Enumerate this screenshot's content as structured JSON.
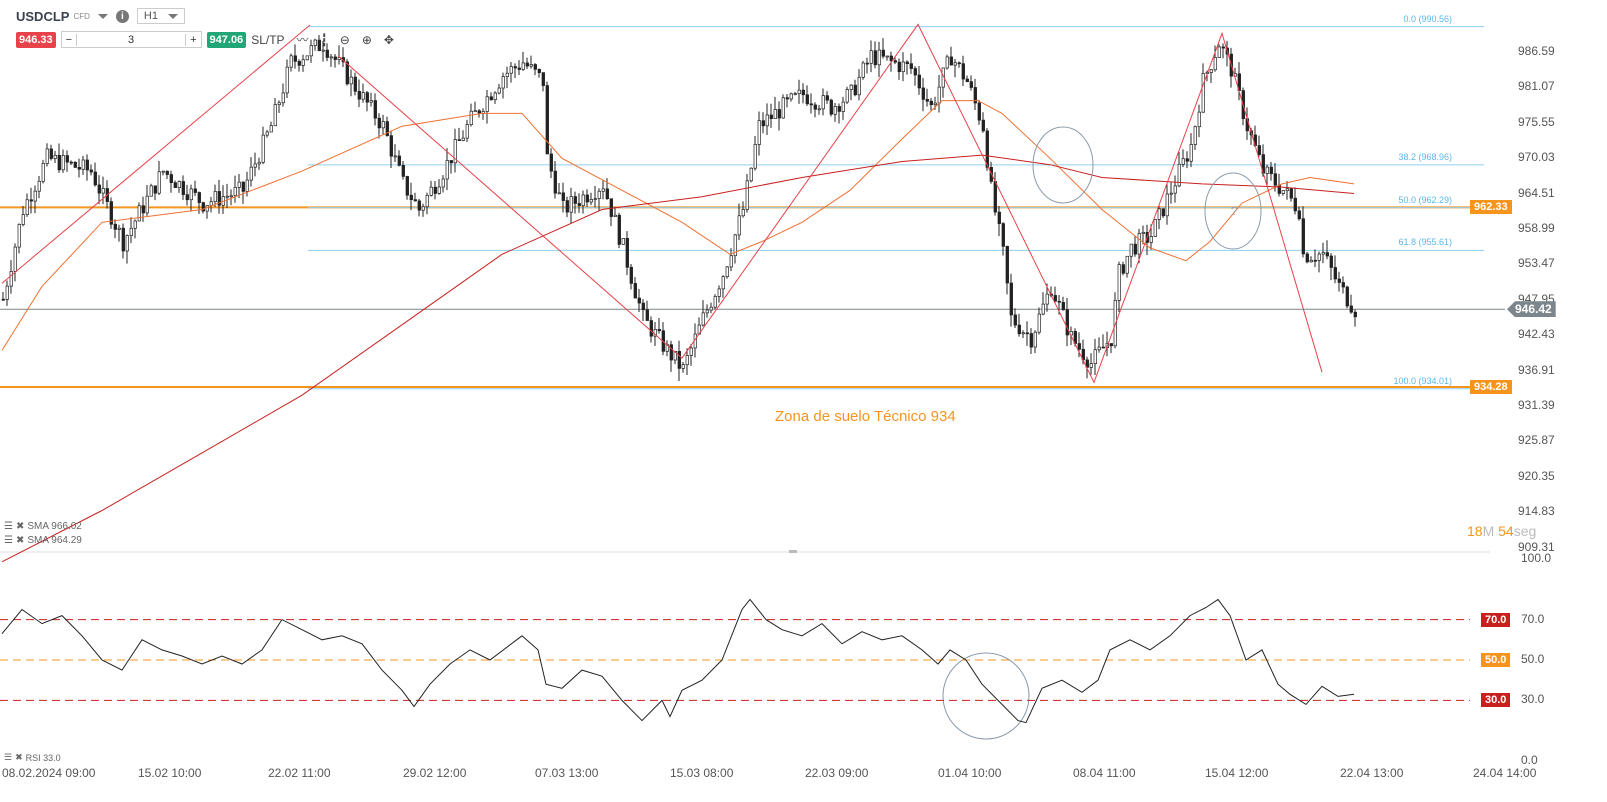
{
  "header": {
    "symbol": "USDCLP",
    "type": "CFD",
    "timeframe": "H1",
    "sell_price": "946.33",
    "buy_price": "947.06",
    "quantity": "3",
    "sltp_label": "SL/TP"
  },
  "colors": {
    "sell": "#e8424a",
    "buy": "#21a777",
    "orange": "#f7941d",
    "fib": "#5bb8e8",
    "zigzag": "#e8424a",
    "sma_fast": "#f07030",
    "sma_slow": "#c8201e"
  },
  "price_axis": {
    "ticks": [
      "986.59",
      "981.07",
      "975.55",
      "970.03",
      "964.51",
      "958.99",
      "953.47",
      "947.95",
      "942.43",
      "936.91",
      "931.39",
      "925.87",
      "920.35",
      "914.83",
      "909.31"
    ],
    "current_price": "946.42",
    "level_tags": [
      "962.33",
      "934.28"
    ]
  },
  "rsi_axis": {
    "ticks": [
      "100.0",
      "70.0",
      "50.0",
      "30.0",
      "0.0"
    ],
    "tag_70": "70.0",
    "tag_50": "50.0",
    "tag_30": "30.0"
  },
  "time_axis": [
    "08.02.2024 09:00",
    "15.02 10:00",
    "22.02 11:00",
    "29.02 12:00",
    "07.03 13:00",
    "15.03 08:00",
    "22.03 09:00",
    "01.04 10:00",
    "08.04 11:00",
    "15.04 12:00",
    "22.04 13:00",
    "24.04 14:00"
  ],
  "fib_levels": [
    {
      "label": "0.0 (990.56)",
      "price": 990.56
    },
    {
      "label": "38.2 (968.96)",
      "price": 968.96
    },
    {
      "label": "50.0 (962.29)",
      "price": 962.29
    },
    {
      "label": "61.8 (955.61)",
      "price": 955.61
    },
    {
      "label": "100.0 (934.01)",
      "price": 934.01
    }
  ],
  "annotation": "Zona de suelo Técnico 934",
  "question_mark": "?",
  "legend": {
    "sma1": "SMA 966.02",
    "sma2": "SMA 964.29",
    "rsi": "RSI 33.0"
  },
  "timer": {
    "min": "18",
    "min_unit": "M",
    "sec": "54",
    "sec_unit": "seg"
  },
  "chart_data": {
    "type": "candlestick",
    "price_range": [
      909.31,
      986.59
    ],
    "close_waypoints": [
      [
        0,
        948
      ],
      [
        5,
        962
      ],
      [
        11,
        970
      ],
      [
        22,
        968
      ],
      [
        30,
        957
      ],
      [
        40,
        968
      ],
      [
        50,
        963
      ],
      [
        60,
        965
      ],
      [
        67,
        975
      ],
      [
        72,
        985
      ],
      [
        80,
        988
      ],
      [
        87,
        982
      ],
      [
        95,
        975
      ],
      [
        100,
        966
      ],
      [
        104,
        962
      ],
      [
        110,
        968
      ],
      [
        117,
        976
      ],
      [
        125,
        983
      ],
      [
        130,
        985
      ],
      [
        135,
        982
      ],
      [
        136,
        970
      ],
      [
        140,
        962
      ],
      [
        150,
        966
      ],
      [
        155,
        956
      ],
      [
        160,
        945
      ],
      [
        166,
        940
      ],
      [
        170,
        937
      ],
      [
        175,
        945
      ],
      [
        180,
        952
      ],
      [
        185,
        962
      ],
      [
        189,
        975
      ],
      [
        195,
        978
      ],
      [
        200,
        980
      ],
      [
        207,
        978
      ],
      [
        212,
        980
      ],
      [
        217,
        986
      ],
      [
        222,
        985
      ],
      [
        227,
        984
      ],
      [
        232,
        978
      ],
      [
        237,
        986
      ],
      [
        241,
        982
      ],
      [
        245,
        975
      ],
      [
        247,
        965
      ],
      [
        250,
        955
      ],
      [
        252,
        945
      ],
      [
        257,
        942
      ],
      [
        262,
        950
      ],
      [
        267,
        942
      ],
      [
        272,
        938
      ],
      [
        277,
        942
      ],
      [
        279,
        952
      ],
      [
        282,
        956
      ],
      [
        287,
        958
      ],
      [
        292,
        965
      ],
      [
        297,
        972
      ],
      [
        300,
        982
      ],
      [
        304,
        988
      ],
      [
        307,
        984
      ],
      [
        311,
        975
      ],
      [
        315,
        968
      ],
      [
        320,
        965
      ],
      [
        324,
        962
      ],
      [
        325,
        955
      ],
      [
        330,
        955
      ],
      [
        334,
        950
      ],
      [
        338,
        946.42
      ]
    ],
    "sma_fast_waypoints": [
      [
        0,
        940
      ],
      [
        10,
        950
      ],
      [
        25,
        960
      ],
      [
        50,
        962
      ],
      [
        75,
        968
      ],
      [
        100,
        975
      ],
      [
        120,
        977
      ],
      [
        130,
        977
      ],
      [
        140,
        970
      ],
      [
        155,
        965
      ],
      [
        170,
        960
      ],
      [
        182,
        955
      ],
      [
        190,
        957
      ],
      [
        200,
        960
      ],
      [
        212,
        965
      ],
      [
        225,
        973
      ],
      [
        235,
        979
      ],
      [
        244,
        979
      ],
      [
        250,
        977
      ],
      [
        262,
        970
      ],
      [
        275,
        962
      ],
      [
        287,
        956
      ],
      [
        296,
        954
      ],
      [
        302,
        957
      ],
      [
        310,
        963
      ],
      [
        320,
        966
      ],
      [
        327,
        967
      ],
      [
        338,
        966
      ]
    ],
    "sma_slow_waypoints": [
      [
        0,
        907
      ],
      [
        25,
        915
      ],
      [
        50,
        924
      ],
      [
        75,
        933
      ],
      [
        100,
        944
      ],
      [
        125,
        955
      ],
      [
        150,
        962
      ],
      [
        175,
        964
      ],
      [
        200,
        967
      ],
      [
        225,
        969.5
      ],
      [
        245,
        970.5
      ],
      [
        262,
        969
      ],
      [
        275,
        967
      ],
      [
        300,
        966
      ],
      [
        320,
        965.5
      ],
      [
        338,
        964.5
      ]
    ],
    "zigzag_1": [
      [
        0,
        950.5
      ],
      [
        77,
        990.8
      ]
    ],
    "zigzag_2": [
      [
        84,
        986
      ],
      [
        170,
        938.8
      ],
      [
        229,
        990.9
      ],
      [
        273,
        935
      ],
      [
        305,
        989.5
      ],
      [
        330,
        936.6
      ]
    ],
    "rsi_waypoints": [
      [
        0,
        63
      ],
      [
        5,
        75
      ],
      [
        10,
        68
      ],
      [
        15,
        72
      ],
      [
        20,
        62
      ],
      [
        25,
        50
      ],
      [
        30,
        45
      ],
      [
        35,
        60
      ],
      [
        40,
        55
      ],
      [
        45,
        52
      ],
      [
        50,
        48
      ],
      [
        55,
        52
      ],
      [
        60,
        48
      ],
      [
        65,
        55
      ],
      [
        70,
        70
      ],
      [
        75,
        65
      ],
      [
        80,
        60
      ],
      [
        85,
        62
      ],
      [
        90,
        58
      ],
      [
        95,
        45
      ],
      [
        100,
        35
      ],
      [
        103,
        27
      ],
      [
        107,
        38
      ],
      [
        112,
        48
      ],
      [
        117,
        55
      ],
      [
        122,
        50
      ],
      [
        130,
        62
      ],
      [
        134,
        55
      ],
      [
        136,
        38
      ],
      [
        140,
        36
      ],
      [
        145,
        45
      ],
      [
        150,
        42
      ],
      [
        155,
        30
      ],
      [
        160,
        20
      ],
      [
        165,
        30
      ],
      [
        167,
        22
      ],
      [
        170,
        35
      ],
      [
        175,
        40
      ],
      [
        180,
        50
      ],
      [
        185,
        75
      ],
      [
        187,
        80
      ],
      [
        191,
        70
      ],
      [
        195,
        65
      ],
      [
        200,
        62
      ],
      [
        205,
        68
      ],
      [
        210,
        58
      ],
      [
        215,
        64
      ],
      [
        220,
        60
      ],
      [
        225,
        62
      ],
      [
        230,
        55
      ],
      [
        234,
        48
      ],
      [
        237,
        55
      ],
      [
        241,
        50
      ],
      [
        245,
        38
      ],
      [
        250,
        28
      ],
      [
        254,
        20
      ],
      [
        256,
        19
      ],
      [
        260,
        36
      ],
      [
        265,
        40
      ],
      [
        270,
        34
      ],
      [
        274,
        40
      ],
      [
        277,
        55
      ],
      [
        282,
        60
      ],
      [
        287,
        55
      ],
      [
        292,
        62
      ],
      [
        297,
        72
      ],
      [
        301,
        76
      ],
      [
        304,
        80
      ],
      [
        307,
        72
      ],
      [
        311,
        50
      ],
      [
        315,
        55
      ],
      [
        319,
        38
      ],
      [
        322,
        33
      ],
      [
        326,
        28
      ],
      [
        330,
        37
      ],
      [
        334,
        32
      ],
      [
        338,
        33
      ]
    ],
    "rsi_levels": [
      70,
      50,
      30
    ]
  }
}
